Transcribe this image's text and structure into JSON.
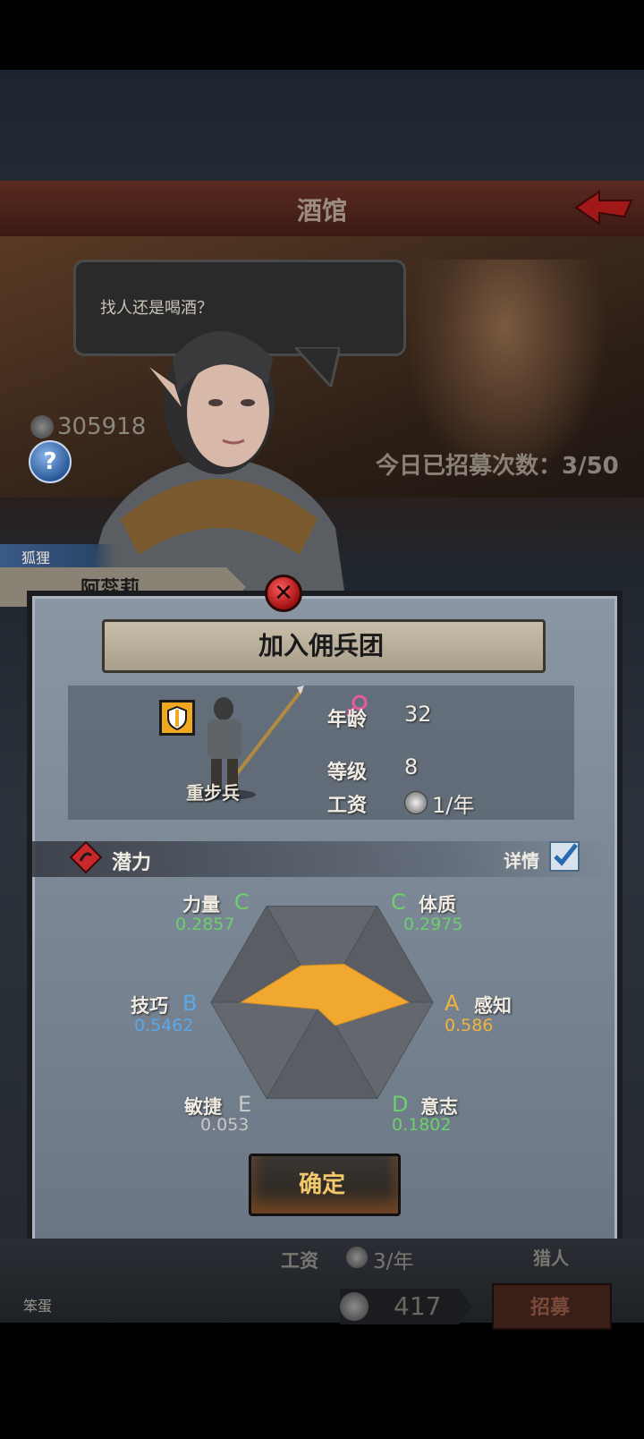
{
  "header": {
    "title": "酒馆",
    "back_icon": "back-arrow-icon"
  },
  "tavern": {
    "speech": "找人还是喝酒？",
    "currency": "305918",
    "recruit_count": "今日已招募次数：3/50"
  },
  "recruit": {
    "race": "狐狸",
    "name": "阿蕊莉"
  },
  "dialog": {
    "title": "加入佣兵团",
    "class_name": "重步兵",
    "gender_icon": "female-icon",
    "age_label": "年龄",
    "age": "32",
    "level_label": "等级",
    "level": "8",
    "wage_label": "工资",
    "wage": "1/年",
    "potential_label": "潜力",
    "details_label": "详情",
    "details_checked": true,
    "confirm_label": "确定"
  },
  "stats": [
    {
      "name": "力量",
      "grade": "C",
      "value": 0.2857
    },
    {
      "name": "体质",
      "grade": "C",
      "value": 0.2975
    },
    {
      "name": "感知",
      "grade": "A",
      "value": 0.586
    },
    {
      "name": "意志",
      "grade": "D",
      "value": 0.1802
    },
    {
      "name": "敏捷",
      "grade": "E",
      "value": 0.053
    },
    {
      "name": "技巧",
      "grade": "B",
      "value": 0.5462
    }
  ],
  "stats_text": {
    "str_name": "力量",
    "str_grade": "C",
    "str_value": "0.2857",
    "con_name": "体质",
    "con_grade": "C",
    "con_value": "0.2975",
    "per_name": "感知",
    "per_grade": "A",
    "per_value": "0.586",
    "wil_name": "意志",
    "wil_grade": "D",
    "wil_value": "0.1802",
    "agi_name": "敏捷",
    "agi_grade": "E",
    "agi_value": "0.053",
    "ski_name": "技巧",
    "ski_grade": "B",
    "ski_value": "0.5462"
  },
  "grade_colors": {
    "A": "#f0b43c",
    "B": "#5aa8e8",
    "C": "#6cd06c",
    "D": "#6cd06c",
    "E": "#c8c8c8"
  },
  "radar_color": "#f0a830",
  "behind": {
    "wage_label": "工资",
    "wage": "3/年",
    "class": "猎人",
    "name": "笨蛋",
    "price": "417",
    "recruit_label": "招募"
  }
}
